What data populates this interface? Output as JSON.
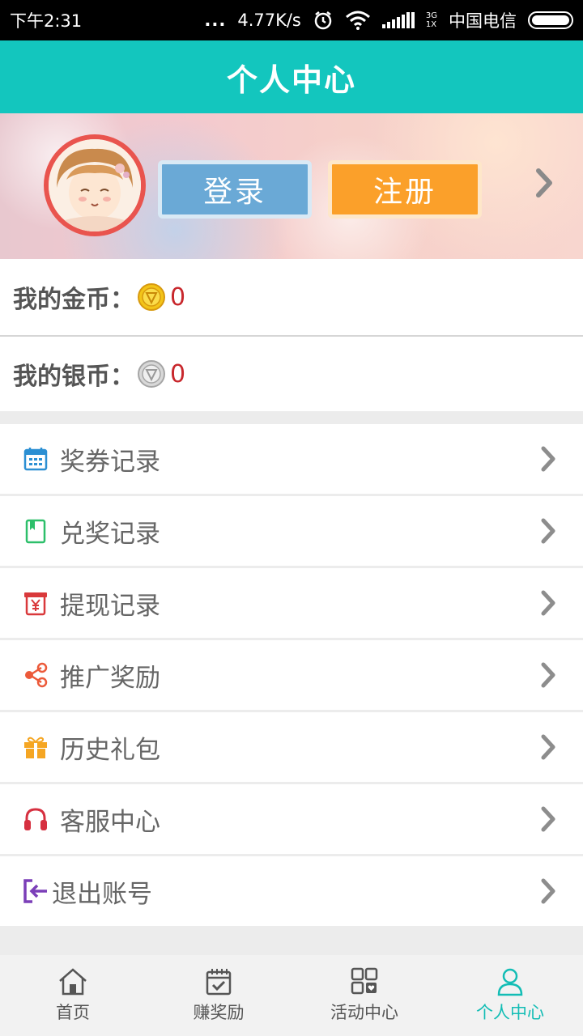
{
  "status_bar": {
    "time": "下午2:31",
    "dots": "...",
    "net_speed": "4.77K/s",
    "network_type": "3G",
    "sim_slot": "1X",
    "carrier": "中国电信"
  },
  "header": {
    "title": "个人中心"
  },
  "profile": {
    "login_label": "登录",
    "register_label": "注册"
  },
  "coins": {
    "gold_label": "我的金币：",
    "gold_value": "0",
    "silver_label": "我的银币：",
    "silver_value": "0"
  },
  "menu": {
    "items": [
      {
        "label": "奖券记录",
        "icon": "calendar-icon",
        "color": "#2b8fd3"
      },
      {
        "label": "兑奖记录",
        "icon": "book-icon",
        "color": "#2dbf6a"
      },
      {
        "label": "提现记录",
        "icon": "yen-icon",
        "color": "#d9393b"
      },
      {
        "label": "推广奖励",
        "icon": "share-icon",
        "color": "#ec5a3a"
      },
      {
        "label": "历史礼包",
        "icon": "gift-icon",
        "color": "#f5a623"
      },
      {
        "label": "客服中心",
        "icon": "headset-icon",
        "color": "#d63040"
      },
      {
        "label": "退出账号",
        "icon": "logout-icon",
        "color": "#7b3fb8"
      }
    ]
  },
  "tabs": [
    {
      "label": "首页",
      "icon": "home-icon"
    },
    {
      "label": "赚奖励",
      "icon": "calendar-check-icon"
    },
    {
      "label": "活动中心",
      "icon": "grid-heart-icon"
    },
    {
      "label": "个人中心",
      "icon": "person-icon",
      "active": true
    }
  ],
  "colors": {
    "accent": "#13c6be",
    "login_button": "#6aa9d6",
    "register_button": "#fba02a",
    "coin_value": "#c8272c"
  }
}
